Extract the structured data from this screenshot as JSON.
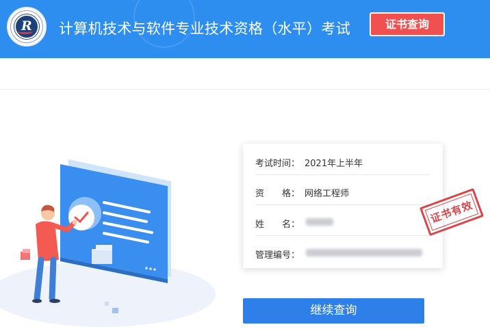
{
  "header": {
    "title": "计算机技术与软件专业技术资格（水平）考试",
    "cert_button": "证书查询",
    "logo_alt": "logo-emblem"
  },
  "certificate": {
    "rows": [
      {
        "label": "考试时间：",
        "value": "2021年上半年"
      },
      {
        "label": "资　　格：",
        "value": "网络工程师"
      },
      {
        "label": "姓　　名：",
        "value": ""
      },
      {
        "label": "管理编号：",
        "value": ""
      }
    ],
    "stamp_text": "证书有效"
  },
  "actions": {
    "continue_label": "继续查询"
  },
  "colors": {
    "header_bg": "#2e8ef0",
    "cert_button_bg": "#f05050",
    "continue_button_bg": "#2f7fe8",
    "stamp": "#d8363b"
  }
}
